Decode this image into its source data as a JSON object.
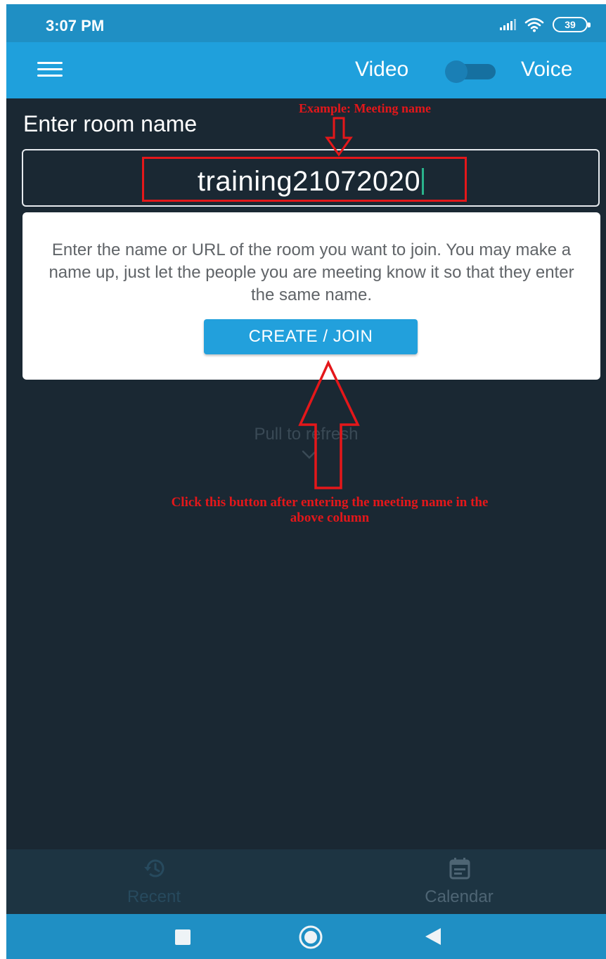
{
  "status_bar": {
    "time": "3:07 PM",
    "battery": "39",
    "icons": [
      "signal-icon",
      "wifi-icon",
      "battery-icon"
    ]
  },
  "app_bar": {
    "menu_icon": "hamburger-menu-icon",
    "mode_left": "Video",
    "mode_right": "Voice",
    "toggle_state": "off"
  },
  "main": {
    "room_label": "Enter room name",
    "room_input_value": "training21072020",
    "info_text": "Enter the name or URL of the room you want to join. You may make a name up, just let the people you are meeting know it so that they enter the same name.",
    "create_join_label": "CREATE / JOIN",
    "pull_to_refresh": "Pull to refresh"
  },
  "bottom_tabs": [
    {
      "label": "Recent",
      "icon": "history-icon"
    },
    {
      "label": "Calendar",
      "icon": "calendar-icon"
    }
  ],
  "nav_bar": {
    "icons": [
      "recents-square-icon",
      "home-circle-icon",
      "back-triangle-icon"
    ]
  },
  "annotations": {
    "top": "Example: Meeting name",
    "bottom": "Click this button after entering the meeting name in the above column"
  },
  "colors": {
    "status_bar": "#1f8fc4",
    "app_bar": "#1fa0dc",
    "background": "#1a2833",
    "button": "#22a0dc",
    "annotation": "#e4171a"
  }
}
